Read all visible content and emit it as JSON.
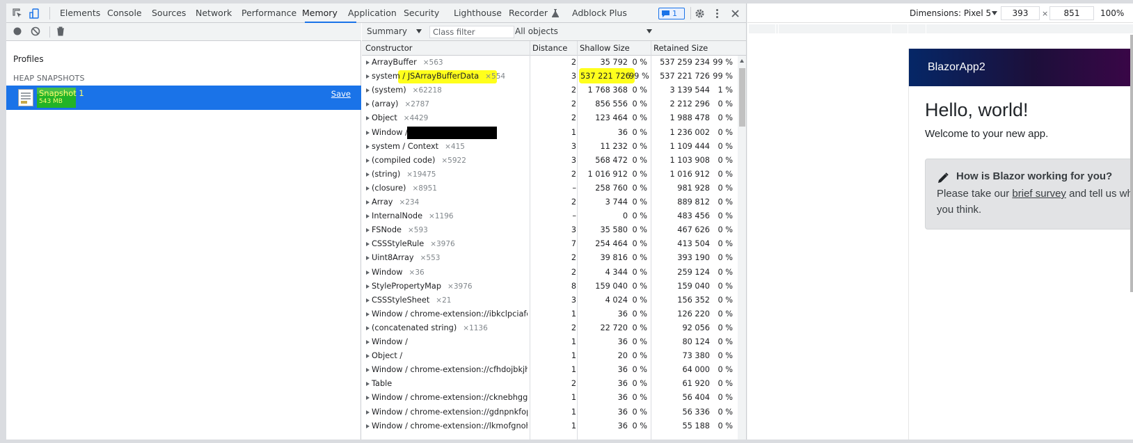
{
  "devtools": {
    "tabs": [
      "Elements",
      "Console",
      "Sources",
      "Network",
      "Performance",
      "Memory",
      "Application",
      "Security",
      "Lighthouse",
      "Recorder",
      "Adblock Plus"
    ],
    "active_tab": "Memory",
    "issues_count": "1",
    "accent_color": "#1a73e8"
  },
  "profiles": {
    "label": "Profiles",
    "section_heading": "HEAP SNAPSHOTS",
    "snapshot": {
      "name": "Snapshot 1",
      "size": "543 MB",
      "save_label": "Save"
    }
  },
  "heap_view": {
    "view_select": "Summary",
    "class_filter_placeholder": "Class filter",
    "objects_select": "All objects",
    "columns": {
      "constructor": "Constructor",
      "distance": "Distance",
      "shallow": "Shallow Size",
      "retained": "Retained Size"
    },
    "rows": [
      {
        "name": "ArrayBuffer",
        "count": "×563",
        "distance": "2",
        "shallow": "35 792",
        "shallow_pct": "0 %",
        "retained": "537 259 234",
        "retained_pct": "99 %"
      },
      {
        "name": "system / JSArrayBufferData",
        "count": "×554",
        "distance": "3",
        "shallow": "537 221 726",
        "shallow_pct": "99 %",
        "retained": "537 221 726",
        "retained_pct": "99 %"
      },
      {
        "name": "(system)",
        "count": "×62218",
        "distance": "2",
        "shallow": "1 768 368",
        "shallow_pct": "0 %",
        "retained": "3 139 544",
        "retained_pct": "1 %"
      },
      {
        "name": "(array)",
        "count": "×2787",
        "distance": "2",
        "shallow": "856 556",
        "shallow_pct": "0 %",
        "retained": "2 212 296",
        "retained_pct": "0 %"
      },
      {
        "name": "Object",
        "count": "×4429",
        "distance": "2",
        "shallow": "123 464",
        "shallow_pct": "0 %",
        "retained": "1 988 478",
        "retained_pct": "0 %"
      },
      {
        "name": "Window /",
        "count": "",
        "distance": "1",
        "shallow": "36",
        "shallow_pct": "0 %",
        "retained": "1 236 002",
        "retained_pct": "0 %"
      },
      {
        "name": "system / Context",
        "count": "×415",
        "distance": "3",
        "shallow": "11 232",
        "shallow_pct": "0 %",
        "retained": "1 109 444",
        "retained_pct": "0 %"
      },
      {
        "name": "(compiled code)",
        "count": "×5922",
        "distance": "3",
        "shallow": "568 472",
        "shallow_pct": "0 %",
        "retained": "1 103 908",
        "retained_pct": "0 %"
      },
      {
        "name": "(string)",
        "count": "×19475",
        "distance": "2",
        "shallow": "1 016 912",
        "shallow_pct": "0 %",
        "retained": "1 016 912",
        "retained_pct": "0 %"
      },
      {
        "name": "(closure)",
        "count": "×8951",
        "distance": "–",
        "shallow": "258 760",
        "shallow_pct": "0 %",
        "retained": "981 928",
        "retained_pct": "0 %"
      },
      {
        "name": "Array",
        "count": "×234",
        "distance": "2",
        "shallow": "3 744",
        "shallow_pct": "0 %",
        "retained": "889 812",
        "retained_pct": "0 %"
      },
      {
        "name": "InternalNode",
        "count": "×1196",
        "distance": "–",
        "shallow": "0",
        "shallow_pct": "0 %",
        "retained": "483 456",
        "retained_pct": "0 %"
      },
      {
        "name": "FSNode",
        "count": "×593",
        "distance": "3",
        "shallow": "35 580",
        "shallow_pct": "0 %",
        "retained": "467 626",
        "retained_pct": "0 %"
      },
      {
        "name": "CSSStyleRule",
        "count": "×3976",
        "distance": "7",
        "shallow": "254 464",
        "shallow_pct": "0 %",
        "retained": "413 504",
        "retained_pct": "0 %"
      },
      {
        "name": "Uint8Array",
        "count": "×553",
        "distance": "2",
        "shallow": "39 816",
        "shallow_pct": "0 %",
        "retained": "393 190",
        "retained_pct": "0 %"
      },
      {
        "name": "Window",
        "count": "×36",
        "distance": "2",
        "shallow": "4 344",
        "shallow_pct": "0 %",
        "retained": "259 124",
        "retained_pct": "0 %"
      },
      {
        "name": "StylePropertyMap",
        "count": "×3976",
        "distance": "8",
        "shallow": "159 040",
        "shallow_pct": "0 %",
        "retained": "159 040",
        "retained_pct": "0 %"
      },
      {
        "name": "CSSStyleSheet",
        "count": "×21",
        "distance": "3",
        "shallow": "4 024",
        "shallow_pct": "0 %",
        "retained": "156 352",
        "retained_pct": "0 %"
      },
      {
        "name": "Window / chrome-extension://ibkclpciafd...",
        "count": "",
        "distance": "1",
        "shallow": "36",
        "shallow_pct": "0 %",
        "retained": "126 220",
        "retained_pct": "0 %"
      },
      {
        "name": "(concatenated string)",
        "count": "×1136",
        "distance": "2",
        "shallow": "22 720",
        "shallow_pct": "0 %",
        "retained": "92 056",
        "retained_pct": "0 %"
      },
      {
        "name": "Window /",
        "count": "",
        "distance": "1",
        "shallow": "36",
        "shallow_pct": "0 %",
        "retained": "80 124",
        "retained_pct": "0 %"
      },
      {
        "name": "Object /",
        "count": "",
        "distance": "1",
        "shallow": "20",
        "shallow_pct": "0 %",
        "retained": "73 380",
        "retained_pct": "0 %"
      },
      {
        "name": "Window / chrome-extension://cfhdojbkjh...",
        "count": "",
        "distance": "1",
        "shallow": "36",
        "shallow_pct": "0 %",
        "retained": "64 000",
        "retained_pct": "0 %"
      },
      {
        "name": "Table",
        "count": "",
        "distance": "2",
        "shallow": "36",
        "shallow_pct": "0 %",
        "retained": "61 920",
        "retained_pct": "0 %"
      },
      {
        "name": "Window / chrome-extension://cknebhggc...",
        "count": "",
        "distance": "1",
        "shallow": "36",
        "shallow_pct": "0 %",
        "retained": "56 404",
        "retained_pct": "0 %"
      },
      {
        "name": "Window / chrome-extension://gdnpnkfop...",
        "count": "",
        "distance": "1",
        "shallow": "36",
        "shallow_pct": "0 %",
        "retained": "56 336",
        "retained_pct": "0 %"
      },
      {
        "name": "Window / chrome-extension://lkmofgnoh...",
        "count": "",
        "distance": "1",
        "shallow": "36",
        "shallow_pct": "0 %",
        "retained": "55 188",
        "retained_pct": "0 %"
      }
    ]
  },
  "device_toolbar": {
    "dimensions_label": "Dimensions: Pixel 5",
    "width": "393",
    "times": "×",
    "height": "851",
    "zoom": "100%"
  },
  "page": {
    "app_title": "BlazorApp2",
    "heading": "Hello, world!",
    "welcome": "Welcome to your new app.",
    "survey_title": "How is Blazor working for you?",
    "survey_text_before": "Please take our ",
    "survey_link": "brief survey",
    "survey_text_after": " and tell us what you think."
  }
}
